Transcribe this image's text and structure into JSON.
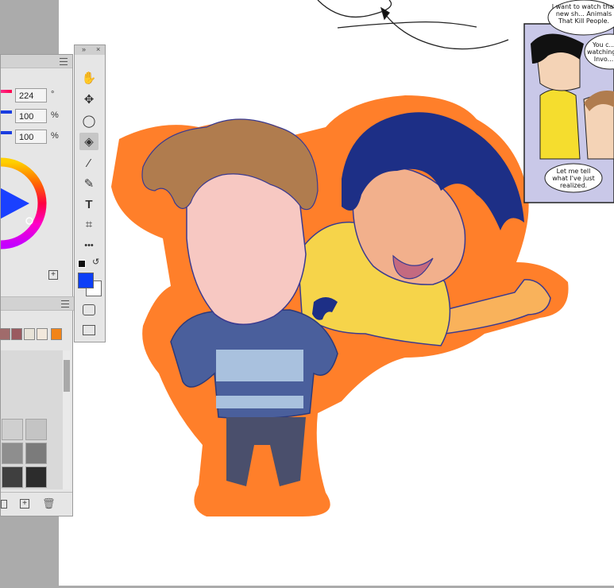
{
  "color_panel": {
    "hue_value": "224",
    "hue_unit": "°",
    "saturation_value": "100",
    "saturation_unit": "%",
    "brightness_value": "100",
    "brightness_unit": "%",
    "foreground_color": "#0d3ff7",
    "background_color": "#ffffff"
  },
  "swatches": [
    "#a06b6b",
    "#9a5a5f",
    "#e8e3d8",
    "#f2e8dc",
    "#f28418"
  ],
  "grays": [
    "#cfcfcf",
    "#c4c4c4",
    "#8e8e8e",
    "#7b7b7b",
    "#3f3f3f",
    "#2c2c2c"
  ],
  "tools": [
    {
      "name": "hand-tool",
      "icon": "✋"
    },
    {
      "name": "move-tool",
      "icon": "✥"
    },
    {
      "name": "lasso-tool",
      "icon": "◯"
    },
    {
      "name": "fill-tool",
      "icon": "◈"
    },
    {
      "name": "eyedropper-tool",
      "icon": "⁄"
    },
    {
      "name": "brush-tool",
      "icon": "✎"
    },
    {
      "name": "text-tool",
      "icon": "T"
    },
    {
      "name": "crop-tool",
      "icon": "⌗"
    },
    {
      "name": "more-tools",
      "icon": "•••"
    }
  ],
  "comic": {
    "bubble1": "I want to watch that new sh... Animals That Kill People.",
    "bubble2": "You c... watching... Invo...",
    "bubble3": "Let me tell what I've just realized."
  }
}
